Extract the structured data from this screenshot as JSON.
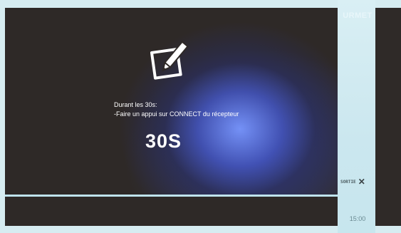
{
  "screen": {
    "title_line": "Durant les 30s:",
    "instruction_line": "-Faire un appui sur CONNECT du récepteur",
    "countdown": "30S"
  },
  "side_panel": {
    "brand": "URMET",
    "exit_label": "SORTIE",
    "exit_icon": "close-icon",
    "clock": "15:00"
  },
  "icons": {
    "main": "edit-icon"
  },
  "colors": {
    "background_dark": "#2e2927",
    "glow_blue": "#7896ff",
    "panel_light": "#d6ecf1",
    "text": "#ffffff"
  }
}
